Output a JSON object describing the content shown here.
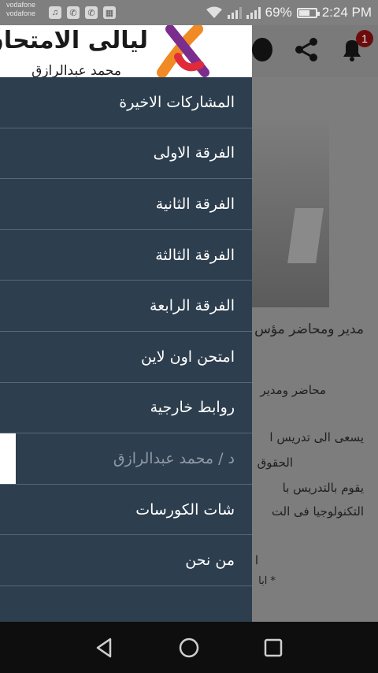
{
  "status_bar": {
    "carrier_1": "vodafone",
    "carrier_2": "vodafone",
    "battery_percent": "69%",
    "battery_level": 0.69,
    "time": "2:24 PM",
    "notification_icons": [
      "music-note-icon",
      "viber-icon",
      "viber-icon",
      "gallery-icon"
    ]
  },
  "appbar": {
    "notification_count": "1"
  },
  "drawer": {
    "logo_title": "ليالى الامتحان",
    "logo_subtitle": "محمد عبدالرازق",
    "items": [
      {
        "label": "المشاركات الاخيرة"
      },
      {
        "label": "الفرقة الاولى"
      },
      {
        "label": "الفرقة الثانية"
      },
      {
        "label": "الفرقة الثالثة"
      },
      {
        "label": "الفرقة الرابعة"
      },
      {
        "label": "امتحن اون لاين"
      },
      {
        "label": "روابط خارجية"
      },
      {
        "label": "د / محمد عبدالرازق",
        "active": true
      },
      {
        "label": "شات الكورسات"
      },
      {
        "label": "من نحن"
      }
    ]
  },
  "background_content": {
    "headline": "مدير ومحاضر مؤس",
    "line_1": "محاضر ومدير",
    "line_2": "يسعى الى تدريس ا",
    "line_3": "الحقوق",
    "line_4": "يقوم بالتدريس با",
    "line_5": "التكنولوجيا فى الت",
    "line_6": "ا",
    "line_7": "* ابا"
  },
  "colors": {
    "drawer_bg": "#2d3e4e",
    "divider": "#56687a",
    "badge": "#6b0c0c",
    "logo_orange": "#f08a24",
    "logo_purple": "#7b2d8e",
    "logo_red": "#e02b3b"
  }
}
